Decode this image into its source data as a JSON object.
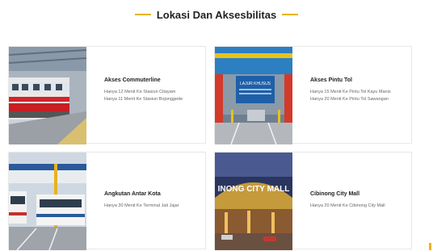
{
  "section": {
    "title": "Lokasi Dan Aksesbilitas",
    "accent_color": "#e6b400"
  },
  "cards": [
    {
      "title": "Akses Commuterline",
      "image": "commuter-train-photo",
      "lines": [
        "Hanya 12 Menit Ke Stasiun Citayam",
        "Hanya 11 Menit Ke Stasiun Bojonggede"
      ]
    },
    {
      "title": "Akses Pintu Tol",
      "image": "toll-gate-photo",
      "sign_text": "LAJUR KHUSUS",
      "lines": [
        "Hanya 15 Menit Ke Pintu Tol Kayu Manis",
        "Hanya 20 Menit Ke Pintu Tol Sawangan"
      ]
    },
    {
      "title": "Angkutan Antar Kota",
      "image": "bus-terminal-photo",
      "lines": [
        "Hanya 30 Menit Ke Terminal Jati Jajar"
      ]
    },
    {
      "title": "Cibinong City Mall",
      "image": "mall-photo",
      "sign_text": "INONG CITY MALL",
      "lines": [
        "Hanya 20 Menit Ke Cibinong City Mall"
      ]
    }
  ]
}
